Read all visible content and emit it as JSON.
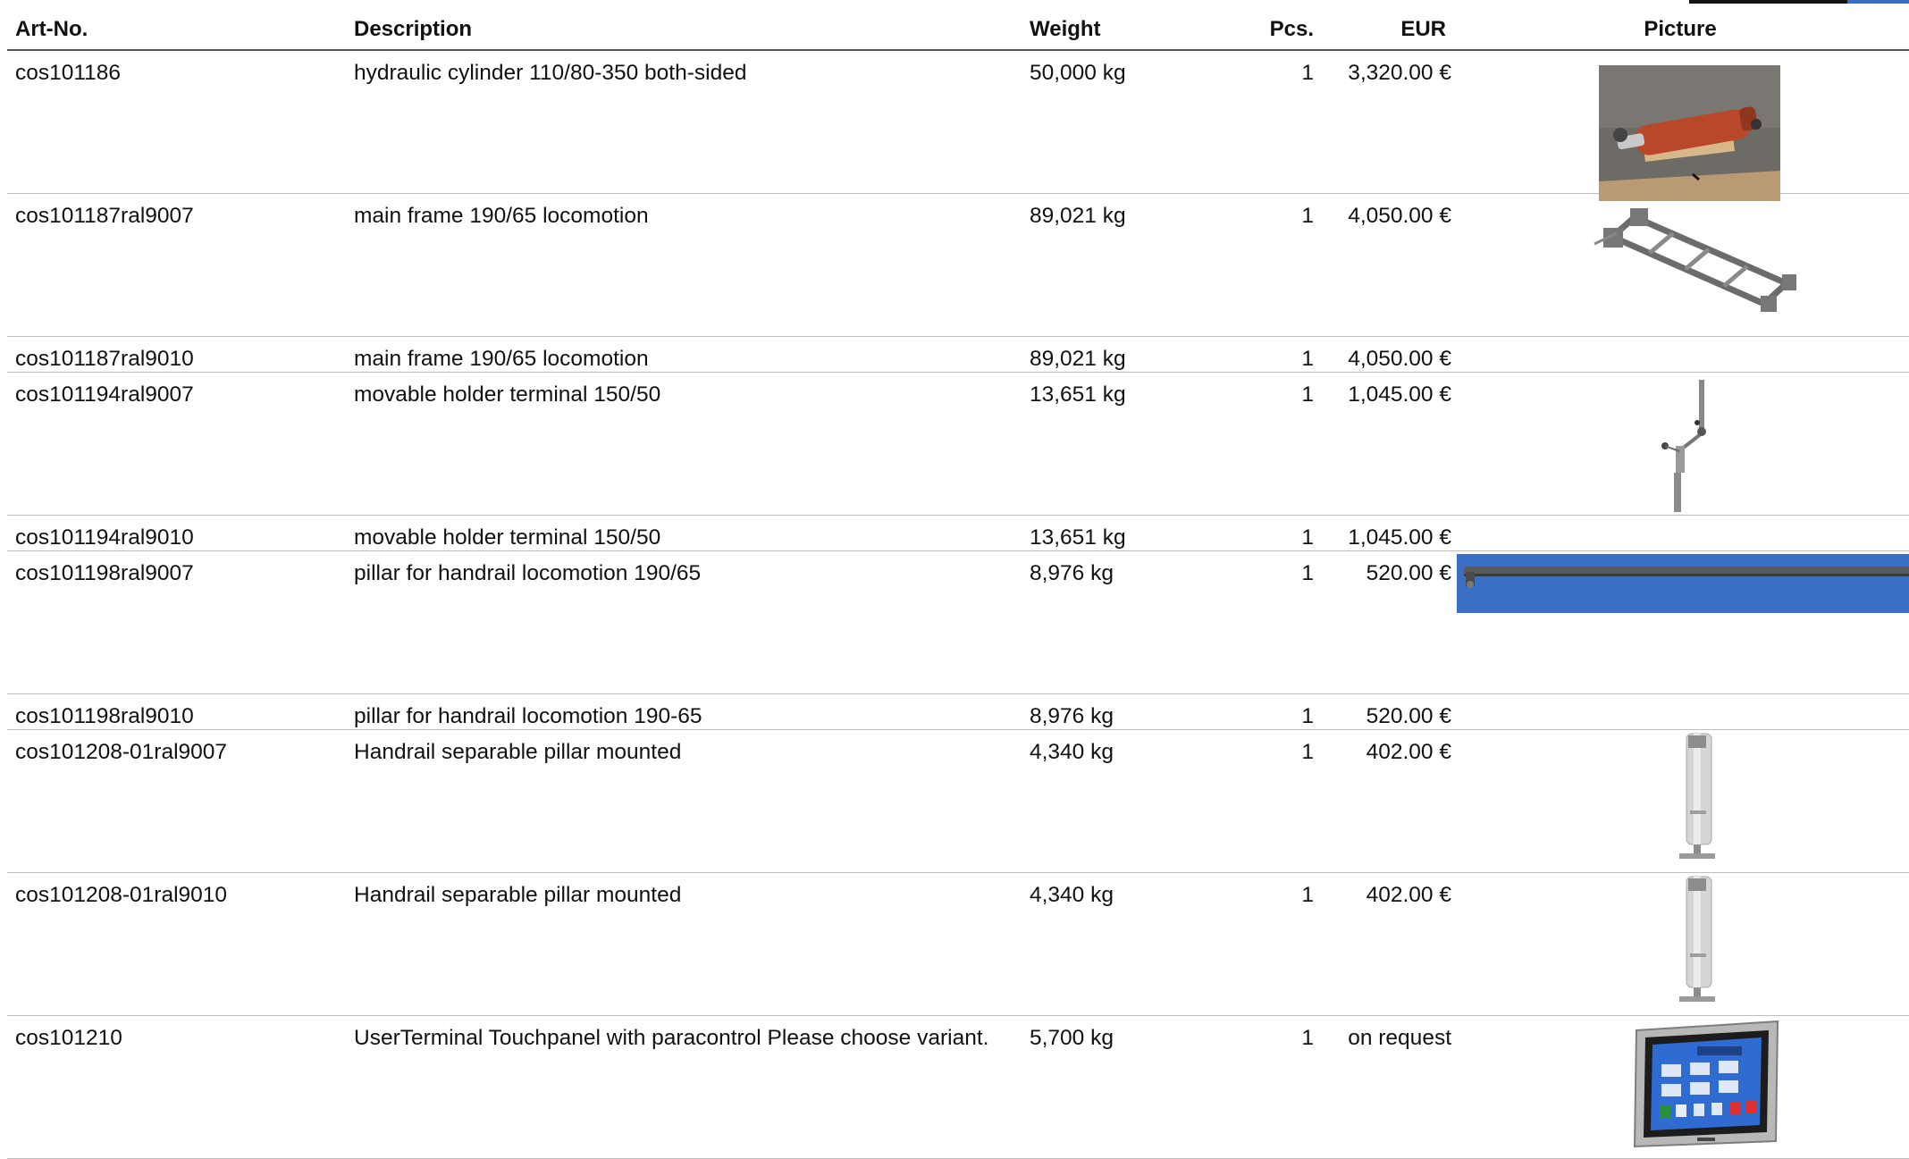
{
  "header": {
    "art_no": "Art-No.",
    "description": "Description",
    "weight": "Weight",
    "pcs": "Pcs.",
    "eur": "EUR",
    "picture": "Picture"
  },
  "rows": [
    {
      "art_no": "cos101186",
      "description": "hydraulic cylinder 110/80-350 both-sided",
      "weight": "50,000 kg",
      "pcs": "1",
      "eur": "3,320.00 €",
      "picture": "hydraulic-cylinder-photo"
    },
    {
      "art_no": "cos101187ral9007",
      "description": "main frame 190/65 locomotion",
      "weight": "89,021 kg",
      "pcs": "1",
      "eur": "4,050.00 €",
      "picture": "main-frame-drawing"
    },
    {
      "art_no": "cos101187ral9010",
      "description": "main frame 190/65 locomotion",
      "weight": "89,021 kg",
      "pcs": "1",
      "eur": "4,050.00 €",
      "picture": ""
    },
    {
      "art_no": "cos101194ral9007",
      "description": "movable holder terminal 150/50",
      "weight": "13,651 kg",
      "pcs": "1",
      "eur": "1,045.00 €",
      "picture": "holder-terminal-drawing"
    },
    {
      "art_no": "cos101194ral9010",
      "description": "movable holder terminal 150/50",
      "weight": "13,651 kg",
      "pcs": "1",
      "eur": "1,045.00 €",
      "picture": ""
    },
    {
      "art_no": "cos101198ral9007",
      "description": "pillar for handrail locomotion 190/65",
      "weight": "8,976 kg",
      "pcs": "1",
      "eur": "520.00 €",
      "picture": "handrail-pillar-render"
    },
    {
      "art_no": "cos101198ral9010",
      "description": "pillar for handrail locomotion 190-65",
      "weight": "8,976 kg",
      "pcs": "1",
      "eur": "520.00 €",
      "picture": ""
    },
    {
      "art_no": "cos101208-01ral9007",
      "description": "Handrail separable pillar mounted",
      "weight": "4,340 kg",
      "pcs": "1",
      "eur": "402.00 €",
      "picture": "separable-pillar-drawing"
    },
    {
      "art_no": "cos101208-01ral9010",
      "description": "Handrail separable pillar mounted",
      "weight": "4,340 kg",
      "pcs": "1",
      "eur": "402.00 €",
      "picture": "separable-pillar-drawing"
    },
    {
      "art_no": "cos101210",
      "description": "UserTerminal Touchpanel with paracontrol Please choose variant.",
      "weight": "5,700 kg",
      "pcs": "1",
      "eur": "on request",
      "picture": "touchpanel-photo"
    }
  ],
  "colors": {
    "header_rule": "#555555",
    "row_rule": "#bdbdbd",
    "blue_render": "#3a6fc4"
  }
}
